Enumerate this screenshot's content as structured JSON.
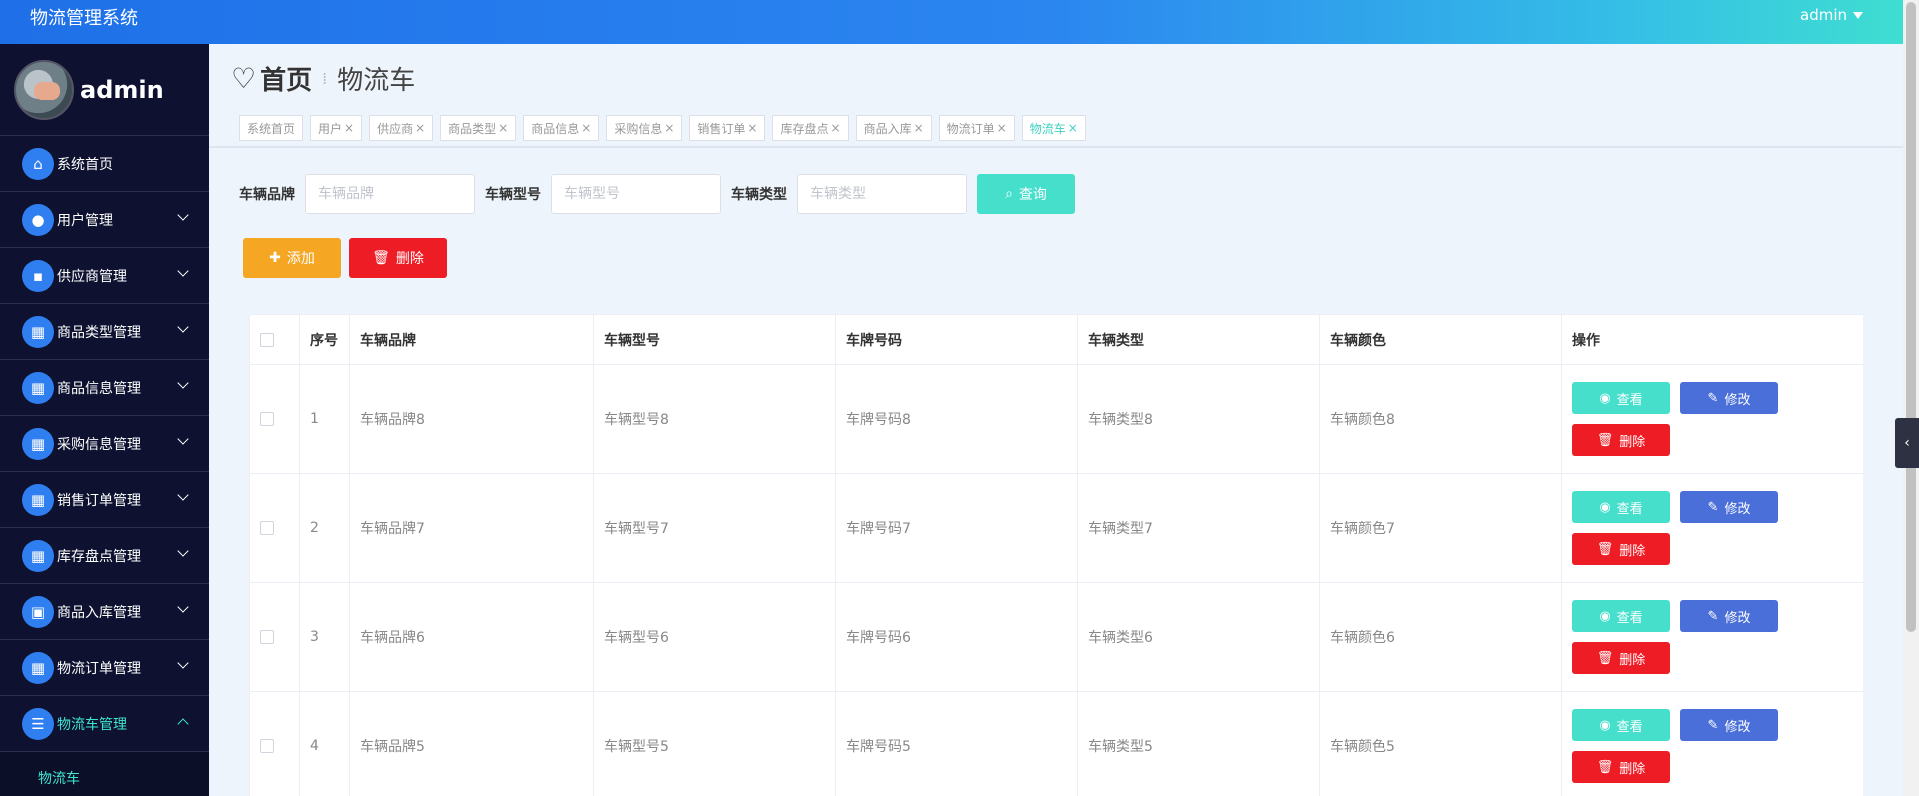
{
  "app": {
    "title": "物流管理系统",
    "user": "admin"
  },
  "sidebar": {
    "profile_name": "admin",
    "items": [
      {
        "label": "系统首页",
        "icon": "home-icon",
        "glyph": "⌂"
      },
      {
        "label": "用户管理",
        "icon": "bulb-icon",
        "glyph": "●"
      },
      {
        "label": "供应商管理",
        "icon": "chat-icon",
        "glyph": "▪"
      },
      {
        "label": "商品类型管理",
        "icon": "grid-icon",
        "glyph": "▦"
      },
      {
        "label": "商品信息管理",
        "icon": "grid-icon",
        "glyph": "▦"
      },
      {
        "label": "采购信息管理",
        "icon": "grid-icon",
        "glyph": "▦"
      },
      {
        "label": "销售订单管理",
        "icon": "grid-icon",
        "glyph": "▦"
      },
      {
        "label": "库存盘点管理",
        "icon": "grid-icon",
        "glyph": "▦"
      },
      {
        "label": "商品入库管理",
        "icon": "briefcase-icon",
        "glyph": "▣"
      },
      {
        "label": "物流订单管理",
        "icon": "grid-icon",
        "glyph": "▦"
      },
      {
        "label": "物流车管理",
        "icon": "list-icon",
        "glyph": "☰"
      }
    ],
    "submenu": {
      "label": "物流车"
    }
  },
  "breadcrumb": {
    "home": "首页",
    "current": "物流车"
  },
  "tabs": [
    {
      "label": "系统首页",
      "closable": false
    },
    {
      "label": "用户",
      "closable": true
    },
    {
      "label": "供应商",
      "closable": true
    },
    {
      "label": "商品类型",
      "closable": true
    },
    {
      "label": "商品信息",
      "closable": true
    },
    {
      "label": "采购信息",
      "closable": true
    },
    {
      "label": "销售订单",
      "closable": true
    },
    {
      "label": "库存盘点",
      "closable": true
    },
    {
      "label": "商品入库",
      "closable": true
    },
    {
      "label": "物流订单",
      "closable": true
    },
    {
      "label": "物流车",
      "closable": true,
      "active": true
    }
  ],
  "search": {
    "brand_label": "车辆品牌",
    "brand_placeholder": "车辆品牌",
    "model_label": "车辆型号",
    "model_placeholder": "车辆型号",
    "type_label": "车辆类型",
    "type_placeholder": "车辆类型",
    "query_label": "查询"
  },
  "actions": {
    "add_label": "添加",
    "delete_label": "删除"
  },
  "table": {
    "headers": [
      "序号",
      "车辆品牌",
      "车辆型号",
      "车牌号码",
      "车辆类型",
      "车辆颜色",
      "操作"
    ],
    "rows": [
      [
        "1",
        "车辆品牌8",
        "车辆型号8",
        "车牌号码8",
        "车辆类型8",
        "车辆颜色8"
      ],
      [
        "2",
        "车辆品牌7",
        "车辆型号7",
        "车牌号码7",
        "车辆类型7",
        "车辆颜色7"
      ],
      [
        "3",
        "车辆品牌6",
        "车辆型号6",
        "车牌号码6",
        "车辆类型6",
        "车辆颜色6"
      ],
      [
        "4",
        "车辆品牌5",
        "车辆型号5",
        "车牌号码5",
        "车辆类型5",
        "车辆颜色5"
      ]
    ],
    "ops": {
      "view": "查看",
      "edit": "修改",
      "delete": "删除"
    }
  },
  "colors": {
    "accent": "#45dfcc",
    "primary": "#2f7ff0",
    "danger": "#ee1c25",
    "warning": "#f5a623",
    "edit": "#4a6fd8",
    "sidebar_bg": "#0e1230"
  }
}
